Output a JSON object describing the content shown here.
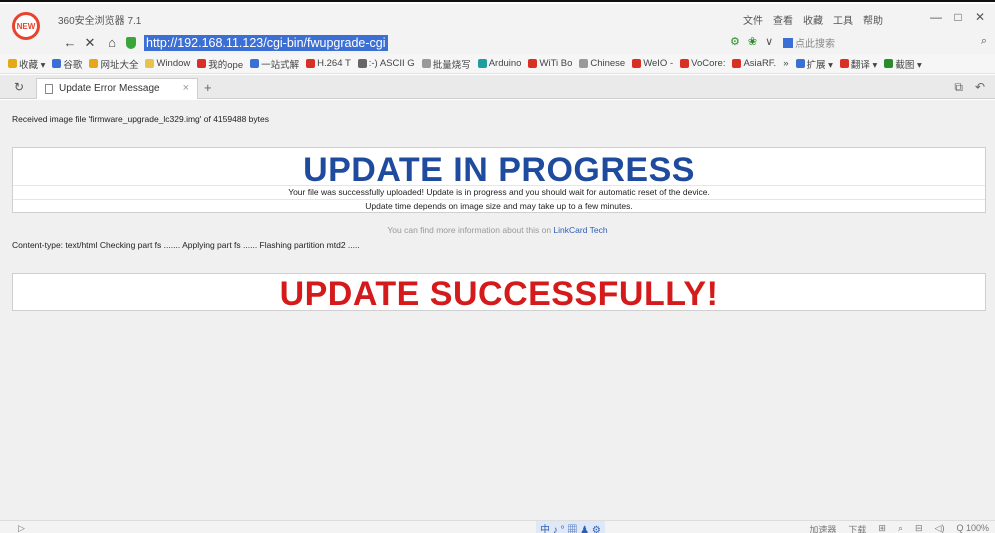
{
  "browser": {
    "app_title": "360安全浏览器 7.1",
    "logo_text": "NEW",
    "top_menu": [
      "文件",
      "查看",
      "收藏",
      "工具",
      "帮助"
    ],
    "window_controls": [
      "—",
      "□",
      "✕"
    ]
  },
  "addressbar": {
    "url": "http://192.168.11.123/cgi-bin/fwupgrade-cgi",
    "search_placeholder": "点此搜索",
    "back": "←",
    "stop": "✕",
    "home": "⌂",
    "dropdown": "∨",
    "search_icon": "⌕"
  },
  "bookmarks": [
    {
      "label": "收藏 ▾",
      "color": "#e6a817"
    },
    {
      "label": "谷歌",
      "color": "#3b6fd4"
    },
    {
      "label": "网址大全",
      "color": "#e6a817"
    },
    {
      "label": "Window",
      "color": "#e6c34a"
    },
    {
      "label": "我的ope",
      "color": "#d93025"
    },
    {
      "label": "一站式解",
      "color": "#3b6fd4"
    },
    {
      "label": "H.264 T",
      "color": "#d93025"
    },
    {
      "label": ":-) ASCII G",
      "color": "#666666"
    },
    {
      "label": "批量烧写",
      "color": "#999999"
    },
    {
      "label": "Arduino",
      "color": "#1e9e9e"
    },
    {
      "label": "WiTi Bo",
      "color": "#d93025"
    },
    {
      "label": "Chinese",
      "color": "#999999"
    },
    {
      "label": "WeIO -",
      "color": "#d93025"
    },
    {
      "label": "VoCore:",
      "color": "#d93025"
    },
    {
      "label": "AsiaRF.",
      "color": "#d93025"
    },
    {
      "label": "»",
      "color": ""
    },
    {
      "label": "扩展 ▾",
      "color": "#3b6fd4"
    },
    {
      "label": "翻译 ▾",
      "color": "#d93025"
    },
    {
      "label": "截图 ▾",
      "color": "#2a8c2a"
    }
  ],
  "tabs": [
    {
      "label": "Update Error Message",
      "close": "×"
    }
  ],
  "tabbar": {
    "new_tab": "+",
    "left_icon": "↻",
    "right_icons": [
      "⧉",
      "↶"
    ]
  },
  "page": {
    "received_text": "Received image file 'firmware_upgrade_lc329.img' of 4159488 bytes",
    "progress_heading": "UPDATE IN PROGRESS",
    "progress_msg1": "Your file was successfully uploaded! Update is in progress and you should wait for automatic reset of the device.",
    "progress_msg2": "Update time depends on image size and may take up to a few minutes.",
    "more_info_prefix": "You can find more information about this on",
    "more_info_link": "LinkCard Tech",
    "content_type_text": "Content-type: text/html Checking part fs ....... Applying part fs ...... Flashing partition mtd2 .....",
    "success_heading": "UPDATE SUCCESSFULLY!"
  },
  "statusbar": {
    "left": "▷",
    "ime": "中 ♪ ° ▦ ♟ ⚙",
    "right_items": [
      "加速器",
      "下载",
      "⊞",
      "⌕",
      "⊟",
      "◁)",
      "Q 100%"
    ]
  },
  "colors": {
    "progress_heading": "#1f4b9e",
    "success_heading": "#d41a1a",
    "url_highlight": "#3b6fd4",
    "link": "#2f5fb4"
  }
}
